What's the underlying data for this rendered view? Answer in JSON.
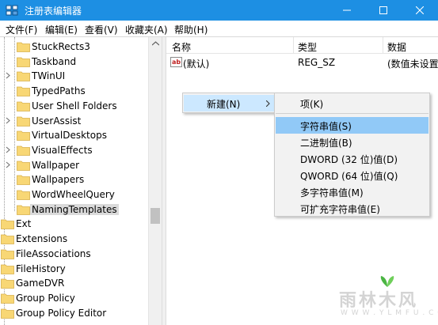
{
  "window": {
    "title": "注册表编辑器"
  },
  "colors": {
    "titlebar": "#1d8fe3",
    "folder": "#f8d775",
    "highlight": "#91c9f7",
    "string_icon": "#c02020"
  },
  "menu": [
    "文件(F)",
    "编辑(E)",
    "查看(V)",
    "收藏夹(A)",
    "帮助(H)"
  ],
  "tree": {
    "items": [
      {
        "label": "StuckRects3",
        "level": 2,
        "expandable": false
      },
      {
        "label": "Taskband",
        "level": 2,
        "expandable": false
      },
      {
        "label": "TWinUI",
        "level": 2,
        "expandable": true
      },
      {
        "label": "TypedPaths",
        "level": 2,
        "expandable": false
      },
      {
        "label": "User Shell Folders",
        "level": 2,
        "expandable": false
      },
      {
        "label": "UserAssist",
        "level": 2,
        "expandable": true
      },
      {
        "label": "VirtualDesktops",
        "level": 2,
        "expandable": false
      },
      {
        "label": "VisualEffects",
        "level": 2,
        "expandable": true
      },
      {
        "label": "Wallpaper",
        "level": 2,
        "expandable": true
      },
      {
        "label": "Wallpapers",
        "level": 2,
        "expandable": false
      },
      {
        "label": "WordWheelQuery",
        "level": 2,
        "expandable": false
      },
      {
        "label": "NamingTemplates",
        "level": 2,
        "expandable": false,
        "selected": true
      },
      {
        "label": "Ext",
        "level": 1,
        "expandable": false
      },
      {
        "label": "Extensions",
        "level": 1,
        "expandable": false
      },
      {
        "label": "FileAssociations",
        "level": 1,
        "expandable": false
      },
      {
        "label": "FileHistory",
        "level": 1,
        "expandable": false
      },
      {
        "label": "GameDVR",
        "level": 1,
        "expandable": false
      },
      {
        "label": "Group Policy",
        "level": 1,
        "expandable": false
      },
      {
        "label": "Group Policy Editor",
        "level": 1,
        "expandable": false
      }
    ]
  },
  "list": {
    "columns": [
      "名称",
      "类型",
      "数据"
    ],
    "rows": [
      {
        "name": "(默认)",
        "type": "REG_SZ",
        "data": "(数值未设置)",
        "icon": "string-value-icon"
      }
    ]
  },
  "context_menu": {
    "new_label": "新建(N)"
  },
  "submenu": {
    "items": [
      "项(K)",
      "字符串值(S)",
      "二进制值(B)",
      "DWORD (32 位)值(D)",
      "QWORD (64 位)值(Q)",
      "多字符串值(M)",
      "可扩充字符串值(E)"
    ],
    "highlighted_index": 1
  },
  "watermark": {
    "text": "雨林木风",
    "url": "W W W . Y L M F U . C O M"
  }
}
